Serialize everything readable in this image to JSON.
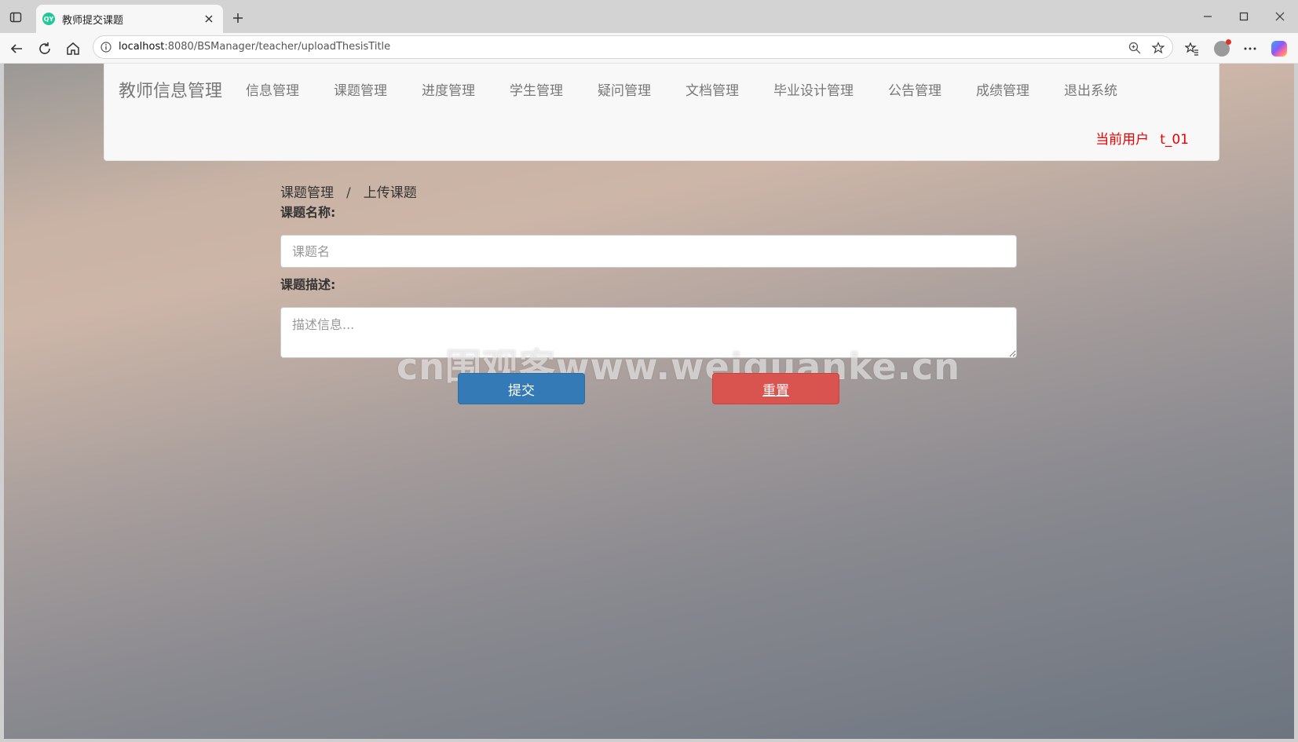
{
  "browser": {
    "tab_title": "教师提交课题",
    "tab_favicon_text": "QY",
    "url_host": "localhost",
    "url_rest": ":8080/BSManager/teacher/uploadThesisTitle"
  },
  "navbar": {
    "brand": "教师信息管理",
    "menu": [
      {
        "label": "信息管理"
      },
      {
        "label": "课题管理"
      },
      {
        "label": "进度管理"
      },
      {
        "label": "学生管理"
      },
      {
        "label": "疑问管理"
      },
      {
        "label": "文档管理"
      },
      {
        "label": "毕业设计管理"
      },
      {
        "label": "公告管理"
      },
      {
        "label": "成绩管理"
      },
      {
        "label": "退出系统"
      }
    ],
    "current_user_label": "当前用户",
    "current_user_name": "t_01"
  },
  "breadcrumb": {
    "parent": "课题管理",
    "separator": "/",
    "current": "上传课题"
  },
  "form": {
    "title_label": "课题名称:",
    "title_placeholder": "课题名",
    "title_value": "",
    "desc_label": "课题描述:",
    "desc_placeholder": "描述信息...",
    "submit_label": "提交",
    "reset_label": "重置"
  },
  "watermark": "cn围观客www.weiguanke.cn",
  "colors": {
    "submit": "#337ab7",
    "reset": "#d9534f",
    "current_user": "#ee0000"
  }
}
